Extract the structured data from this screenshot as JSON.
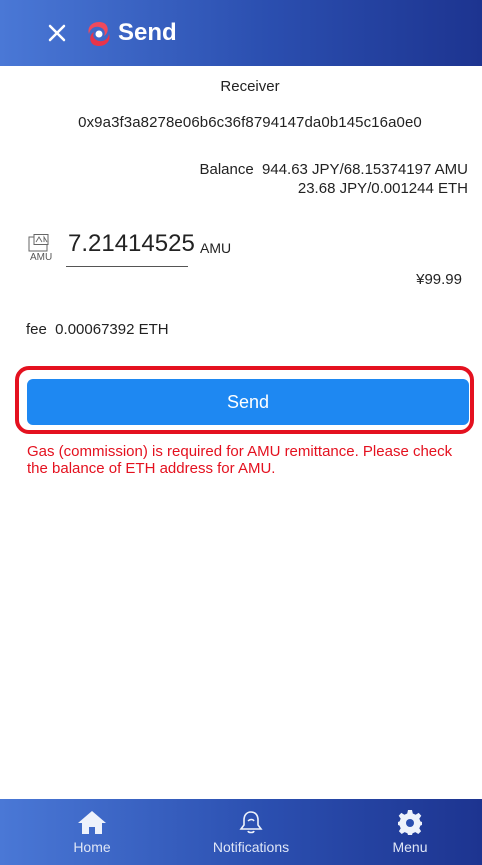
{
  "header": {
    "title": "Send"
  },
  "receiver": {
    "label": "Receiver",
    "address": "0x9a3f3a8278e06b6c36f8794147da0b145c16a0e0"
  },
  "balance": {
    "line1": "Balance  944.63 JPY/68.15374197 AMU",
    "line2": "23.68 JPY/0.001244 ETH"
  },
  "amount": {
    "value": "7.21414525",
    "unit": "AMU",
    "icon_text": "AMU"
  },
  "jpy_value": "¥99.99",
  "fee": "fee  0.00067392 ETH",
  "send_button": "Send",
  "warning": "Gas (commission) is required for AMU remittance. Please check the balance of ETH address for AMU.",
  "colors": {
    "header": "#2b4fb0",
    "send": "#1e88f2",
    "warning": "#e4111f"
  },
  "nav": {
    "home": "Home",
    "notifications": "Notifications",
    "menu": "Menu"
  }
}
